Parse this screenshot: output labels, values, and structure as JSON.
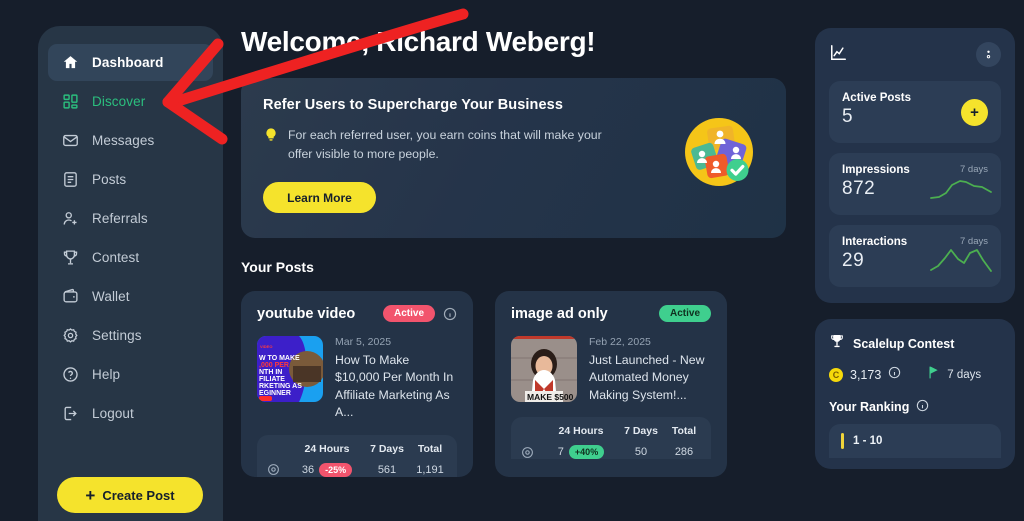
{
  "sidebar": {
    "items": [
      {
        "label": "Dashboard",
        "icon": "home-icon",
        "state": "active"
      },
      {
        "label": "Discover",
        "icon": "grid-icon",
        "state": "highlighted"
      },
      {
        "label": "Messages",
        "icon": "mail-icon",
        "state": "normal"
      },
      {
        "label": "Posts",
        "icon": "document-icon",
        "state": "normal"
      },
      {
        "label": "Referrals",
        "icon": "user-plus-icon",
        "state": "normal"
      },
      {
        "label": "Contest",
        "icon": "trophy-icon",
        "state": "normal"
      },
      {
        "label": "Wallet",
        "icon": "wallet-icon",
        "state": "normal"
      },
      {
        "label": "Settings",
        "icon": "gear-icon",
        "state": "normal"
      },
      {
        "label": "Help",
        "icon": "question-circle-icon",
        "state": "normal"
      },
      {
        "label": "Logout",
        "icon": "logout-icon",
        "state": "normal"
      }
    ],
    "create_post_label": "Create Post",
    "create_post_plus": "+"
  },
  "main": {
    "welcome": "Welcome, Richard Weberg!",
    "refer_card": {
      "title": "Refer Users to Supercharge Your Business",
      "body": "For each referred user, you earn coins that will make your offer visible to more people.",
      "cta": "Learn More",
      "bulb_icon": "lightbulb-icon",
      "art_icon": "referral-network-icon"
    },
    "posts_section_title": "Your Posts",
    "stats_columns": [
      "24 Hours",
      "7 Days",
      "Total"
    ],
    "posts": [
      {
        "name": "youtube video",
        "status": "Active",
        "status_color": "#f2546d",
        "date": "Mar 5, 2025",
        "description": "How To Make $10,000 Per Month In Affiliate Marketing As A...",
        "thumb_lines": [
          "W TO MAKE",
          ",000 PER",
          "NTH IN",
          "FILIATE",
          "RKETING AS",
          "EGINNER"
        ],
        "metrics": {
          "h24": "36",
          "delta": "-25%",
          "delta_sign": "negative",
          "d7": "561",
          "total": "1,191"
        }
      },
      {
        "name": "image ad only",
        "status": "Active",
        "status_color": "#3fcf8e",
        "date": "Feb 22, 2025",
        "description": "Just Launched - New Automated Money Making System!...",
        "thumb_caption": "MAKE $500",
        "metrics": {
          "h24": "7",
          "delta": "+40%",
          "delta_sign": "positive",
          "d7": "50",
          "total": "286"
        }
      }
    ]
  },
  "rail": {
    "header_icon": "line-chart-icon",
    "menu_icon": "kebab-menu-icon",
    "stat_cards": [
      {
        "label": "Active Posts",
        "value": "5",
        "sub": "",
        "action_icon": "plus-icon",
        "action_label": "+"
      },
      {
        "label": "Impressions",
        "value": "872",
        "sub": "7 days",
        "spark": "up-curve"
      },
      {
        "label": "Interactions",
        "value": "29",
        "sub": "7 days",
        "spark": "double-peak"
      }
    ],
    "contest": {
      "icon": "trophy-icon",
      "title": "Scalelup Contest",
      "coin_symbol": "C",
      "coins": "3,173",
      "info_icon": "info-icon",
      "flag_icon": "flag-icon",
      "days": "7 days",
      "ranking_label": "Your Ranking",
      "ranking_info_icon": "info-icon",
      "ranks": [
        {
          "label": "1 - 10",
          "color": "#f0d43a"
        }
      ]
    }
  },
  "annotation": {
    "arrow_color": "#ee2222",
    "arrow_name": "red-pointer-arrow",
    "target": "Discover"
  }
}
